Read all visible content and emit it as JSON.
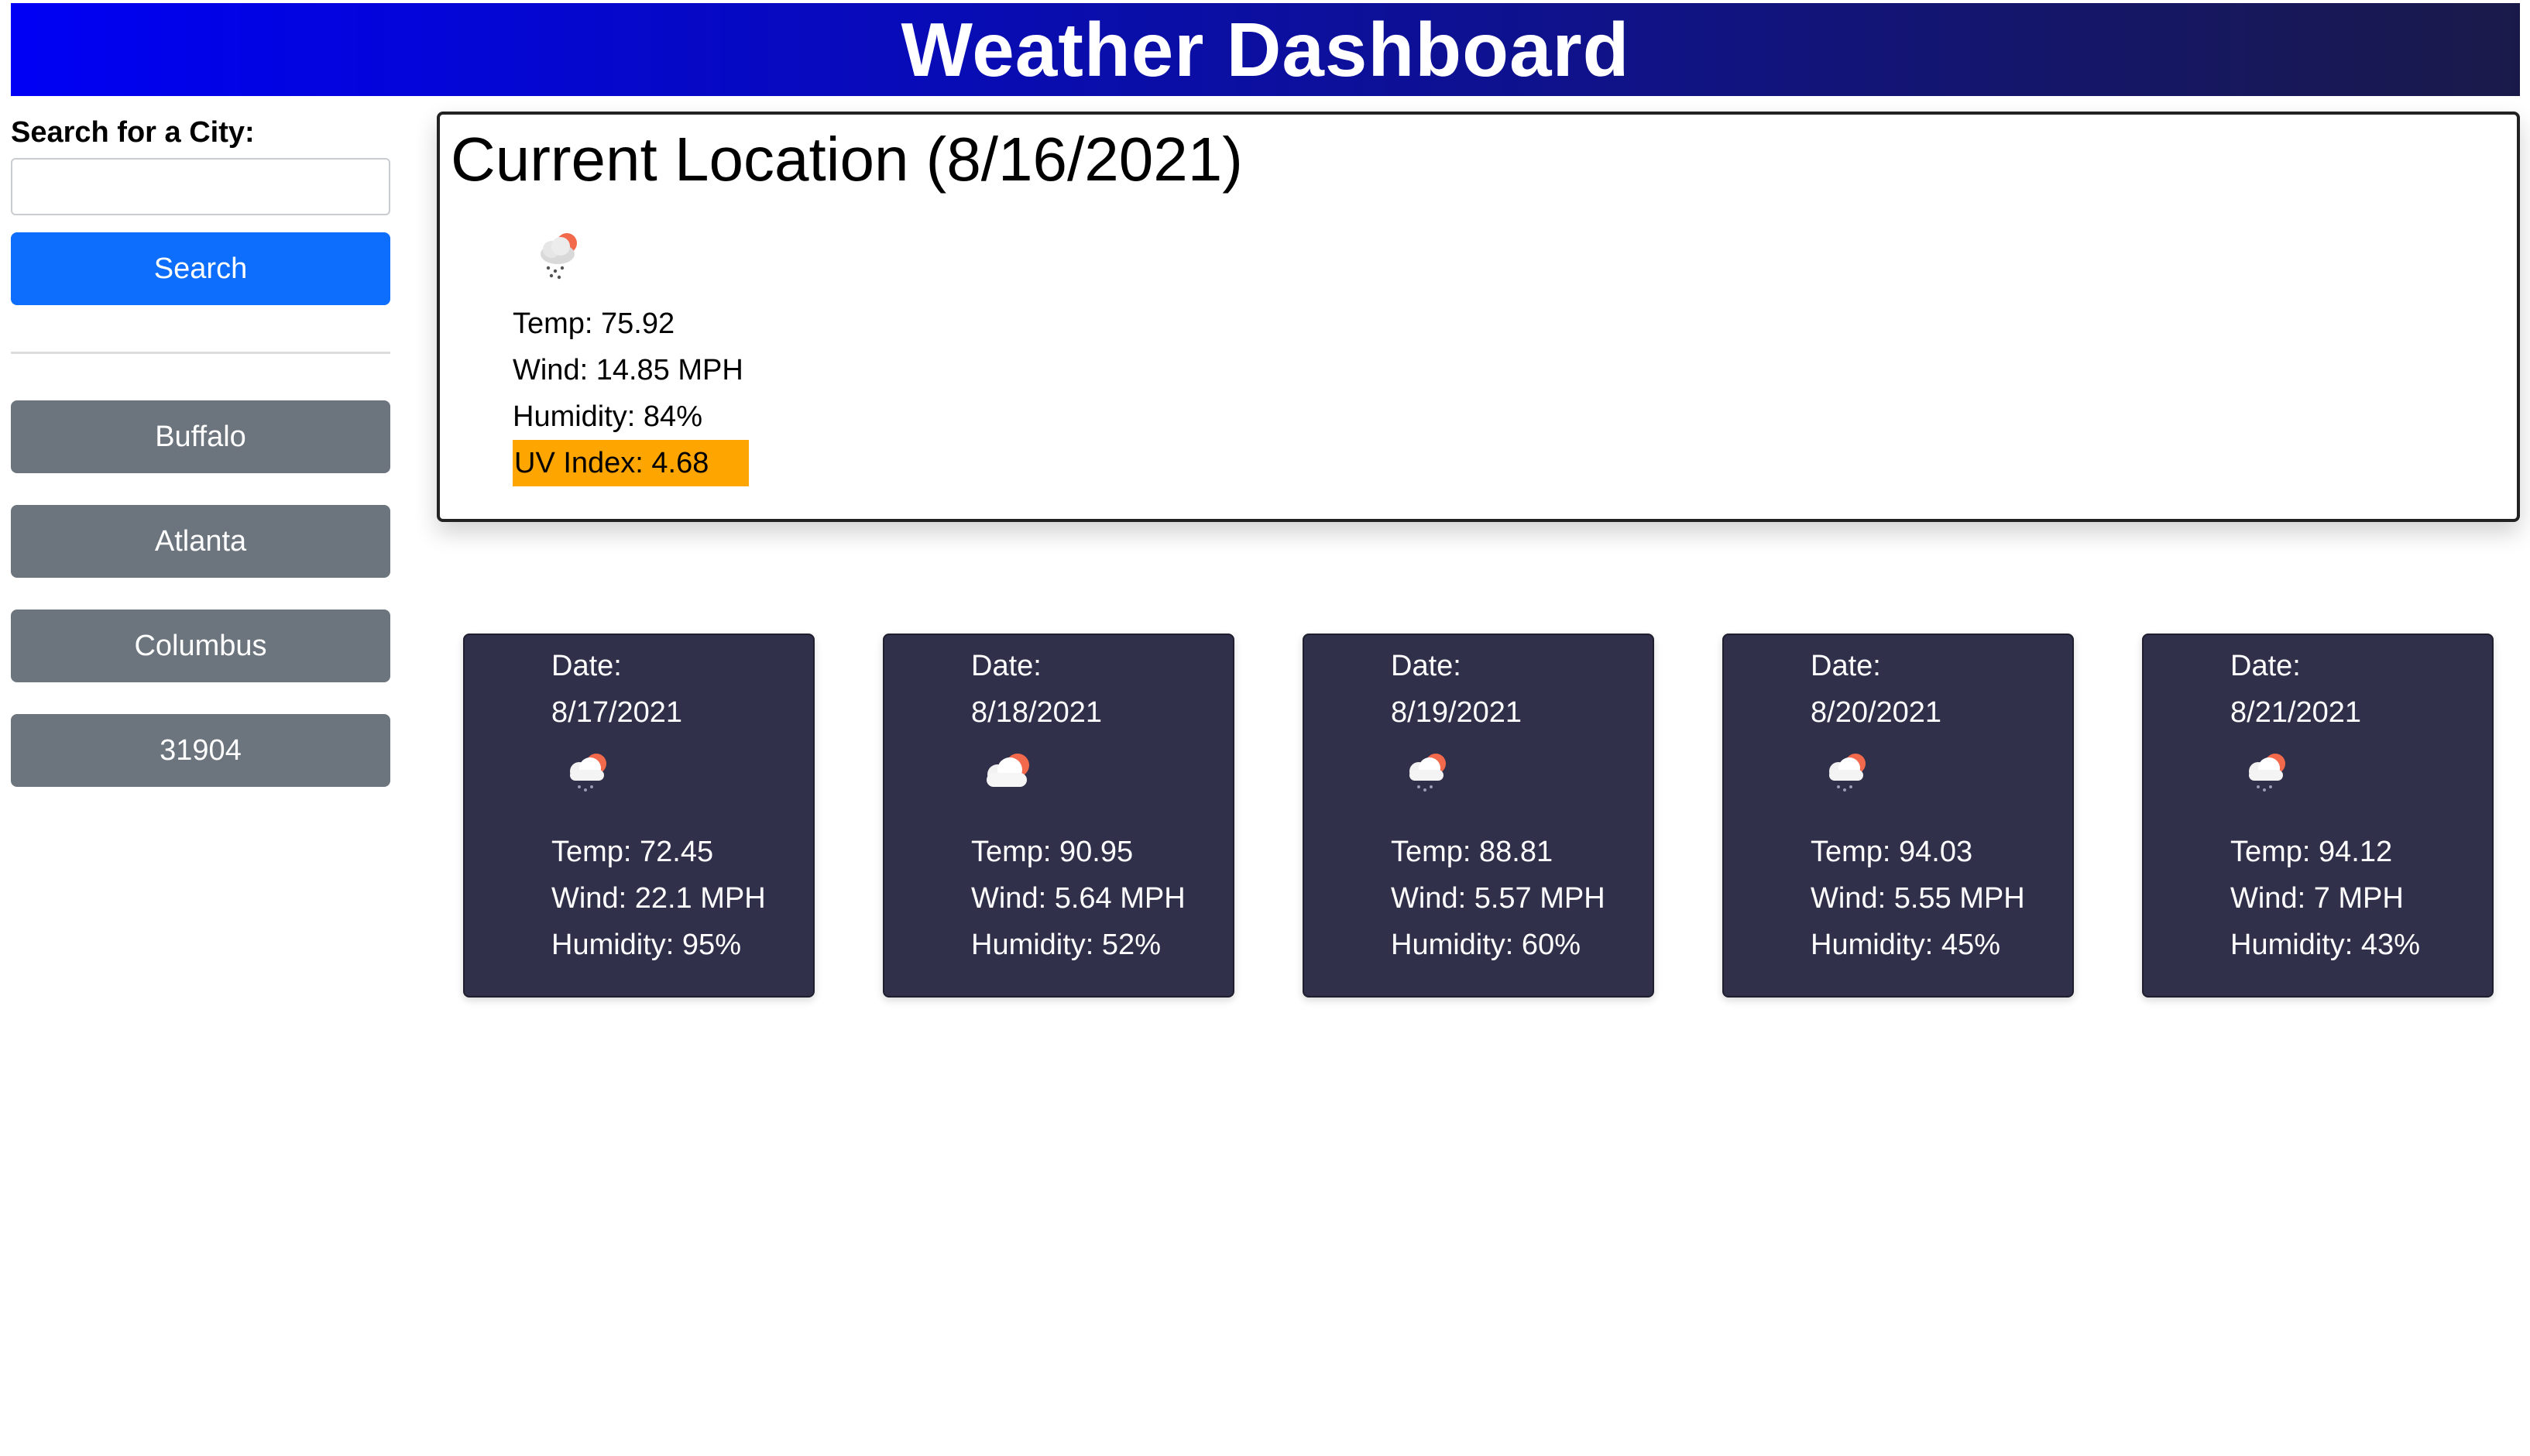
{
  "header": {
    "title": "Weather Dashboard"
  },
  "sidebar": {
    "search_label": "Search for a City:",
    "search_value": "",
    "search_placeholder": "",
    "search_button": "Search",
    "history": [
      "Buffalo",
      "Atlanta",
      "Columbus",
      "31904"
    ]
  },
  "current": {
    "title": "Current Location (8/16/2021)",
    "icon": "cloud-rain-sun-icon",
    "temp": "Temp: 75.92",
    "wind": "Wind: 14.85 MPH",
    "humidity": "Humidity: 84%",
    "uv": "UV Index: 4.68",
    "uv_color": "#ffa500"
  },
  "forecast": [
    {
      "date_label": "Date:",
      "date": "8/17/2021",
      "icon": "cloud-rain-sun-icon",
      "temp": "Temp: 72.45",
      "wind": "Wind: 22.1 MPH",
      "humidity": "Humidity: 95%"
    },
    {
      "date_label": "Date:",
      "date": "8/18/2021",
      "icon": "cloud-sun-icon",
      "temp": "Temp: 90.95",
      "wind": "Wind: 5.64 MPH",
      "humidity": "Humidity: 52%"
    },
    {
      "date_label": "Date:",
      "date": "8/19/2021",
      "icon": "cloud-rain-sun-icon",
      "temp": "Temp: 88.81",
      "wind": "Wind: 5.57 MPH",
      "humidity": "Humidity: 60%"
    },
    {
      "date_label": "Date:",
      "date": "8/20/2021",
      "icon": "cloud-rain-sun-icon",
      "temp": "Temp: 94.03",
      "wind": "Wind: 5.55 MPH",
      "humidity": "Humidity: 45%"
    },
    {
      "date_label": "Date:",
      "date": "8/21/2021",
      "icon": "cloud-rain-sun-icon",
      "temp": "Temp: 94.12",
      "wind": "Wind: 7 MPH",
      "humidity": "Humidity: 43%"
    }
  ],
  "colors": {
    "header_start": "#0000f5",
    "header_end": "#1a1a4a",
    "search_button": "#0d6efd",
    "history_button": "#6c757d",
    "forecast_card": "#30304a"
  }
}
